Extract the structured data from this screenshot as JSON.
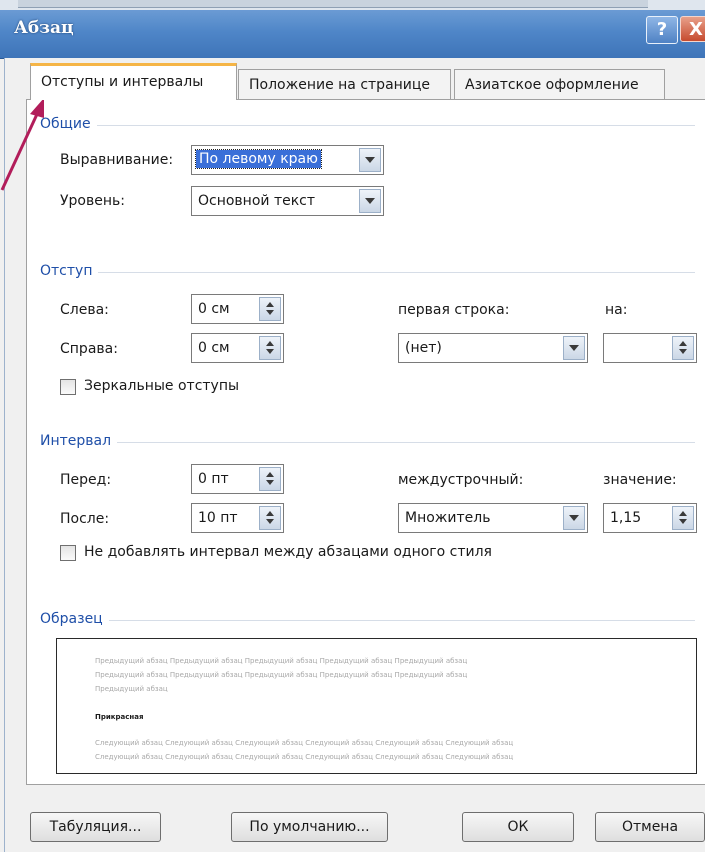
{
  "window": {
    "title": "Абзац",
    "help_label": "?",
    "close_label": "X"
  },
  "tabs": [
    {
      "label": "Отступы и интервалы",
      "active": true
    },
    {
      "label": "Положение на странице",
      "active": false
    },
    {
      "label": "Азиатское оформление",
      "active": false
    }
  ],
  "general": {
    "group": "Общие",
    "alignment_label": "Выравнивание:",
    "alignment_value": "По левому краю",
    "level_label": "Уровень:",
    "level_value": "Основной текст"
  },
  "indent": {
    "group": "Отступ",
    "left_label": "Слева:",
    "left_value": "0 см",
    "right_label": "Справа:",
    "right_value": "0 см",
    "first_line_label": "первая строка:",
    "first_line_value": "(нет)",
    "by_label": "на:",
    "by_value": "",
    "mirror_label": "Зеркальные отступы",
    "mirror_checked": false
  },
  "spacing": {
    "group": "Интервал",
    "before_label": "Перед:",
    "before_value": "0 пт",
    "after_label": "После:",
    "after_value": "10 пт",
    "line_label": "междустрочный:",
    "line_value": "Множитель",
    "at_label": "значение:",
    "at_value": "1,15",
    "no_space_label": "Не добавлять интервал между абзацами одного стиля",
    "no_space_checked": false
  },
  "sample": {
    "group": "Образец",
    "prev_line1": "Предыдущий абзац Предыдущий абзац Предыдущий абзац Предыдущий абзац Предыдущий абзац",
    "prev_line2": "Предыдущий абзац Предыдущий абзац Предыдущий абзац Предыдущий абзац Предыдущий абзац",
    "prev_line3": "Предыдущий абзац",
    "current": "Прикрасная",
    "next_line1": "Следующий абзац Следующий абзац Следующий абзац Следующий абзац Следующий абзац Следующий абзац",
    "next_line2": "Следующий абзац Следующий абзац Следующий абзац Следующий абзац Следующий абзац Следующий абзац"
  },
  "buttons": {
    "tabs": "Табуляция...",
    "default": "По умолчанию...",
    "ok": "ОК",
    "cancel": "Отмена"
  },
  "colors": {
    "accent": "#4f86c8",
    "group_text": "#1f4fa8",
    "selection": "#3a6fd8",
    "annotation_arrow": "#b21d5a"
  }
}
